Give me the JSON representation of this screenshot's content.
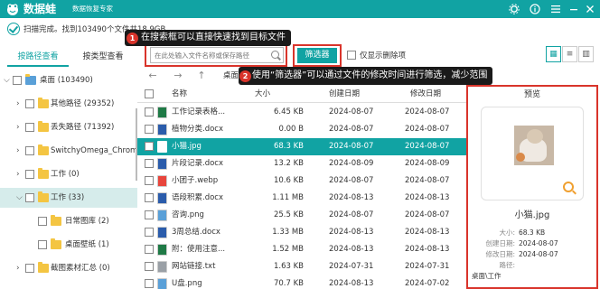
{
  "app": {
    "name": "数据蛙",
    "subtitle": "数据恢复专家"
  },
  "titlebar": {
    "buttons": [
      "gear-icon",
      "info-icon",
      "menu-icon",
      "minimize-icon",
      "close-icon"
    ]
  },
  "scan": {
    "status": "扫描完成。找到103490个文件共18.9GB"
  },
  "tooltip1": {
    "number": "1",
    "text": "在搜索框可以直接快速找到目标文件"
  },
  "tooltip2": {
    "number": "2",
    "text": "使用“筛选器”可以通过文件的修改时间进行筛选，减少范围"
  },
  "sidebar": {
    "tabs": [
      {
        "label": "按路径查看",
        "active": true
      },
      {
        "label": "按类型查看",
        "active": false
      }
    ],
    "tree": [
      {
        "label": "桌面 (103490)",
        "expanded": true,
        "level": 0
      },
      {
        "label": "其他路径 (29352)",
        "expanded": false,
        "level": 1
      },
      {
        "label": "丢失路径 (71392)",
        "expanded": false,
        "level": 1
      },
      {
        "label": "SwitchyOmega_Chromium",
        "expanded": false,
        "level": 1
      },
      {
        "label": "工作 (0)",
        "expanded": false,
        "level": 1
      },
      {
        "label": "工作 (33)",
        "expanded": true,
        "level": 1,
        "selected": true
      },
      {
        "label": "日常图库 (2)",
        "level": 2
      },
      {
        "label": "桌面壁纸 (1)",
        "level": 2
      },
      {
        "label": "截图素材汇总 (0)",
        "expanded": false,
        "level": 1
      }
    ]
  },
  "toolbar": {
    "search_placeholder": "在此处输入文件名称或保存路径",
    "filter_label": "筛选器",
    "show_deleted_label": "仅显示删除项",
    "view_modes": [
      "grid-view-icon",
      "list-view-icon",
      "detail-view-icon"
    ]
  },
  "nav": {
    "path": "桌面"
  },
  "table": {
    "headers": {
      "name": "名称",
      "size": "大小",
      "created": "创建日期",
      "modified": "修改日期"
    },
    "rows": [
      {
        "name": "工作记录表格...",
        "size": "6.45 KB",
        "created": "2024-08-07",
        "modified": "2024-08-07",
        "icon": "excel",
        "color": "#1f7a46"
      },
      {
        "name": "植物分类.docx",
        "size": "0.00 B",
        "created": "2024-08-07",
        "modified": "2024-08-07",
        "icon": "word",
        "color": "#2b5cab"
      },
      {
        "name": "小猫.jpg",
        "size": "68.3 KB",
        "created": "2024-08-07",
        "modified": "2024-08-07",
        "icon": "image",
        "color": "#ffffff",
        "selected": true
      },
      {
        "name": "片段记录.docx",
        "size": "13.2 KB",
        "created": "2024-08-09",
        "modified": "2024-08-09",
        "icon": "word",
        "color": "#2b5cab"
      },
      {
        "name": "小团子.webp",
        "size": "10.6 KB",
        "created": "2024-08-07",
        "modified": "2024-08-07",
        "icon": "chrome",
        "color": "#e8453c"
      },
      {
        "name": "语段积累.docx",
        "size": "1.11 MB",
        "created": "2024-08-13",
        "modified": "2024-08-13",
        "icon": "word",
        "color": "#2b5cab"
      },
      {
        "name": "咨询.png",
        "size": "25.5 KB",
        "created": "2024-08-07",
        "modified": "2024-08-07",
        "icon": "image",
        "color": "#5aa0d8"
      },
      {
        "name": "3周总结.docx",
        "size": "1.33 MB",
        "created": "2024-08-13",
        "modified": "2024-08-13",
        "icon": "word",
        "color": "#2b5cab"
      },
      {
        "name": "附：使用注意...",
        "size": "1.52 MB",
        "created": "2024-08-13",
        "modified": "2024-08-13",
        "icon": "excel",
        "color": "#1f7a46"
      },
      {
        "name": "网站链接.txt",
        "size": "1.63 KB",
        "created": "2024-07-31",
        "modified": "2024-07-31",
        "icon": "text",
        "color": "#9aa0a6"
      },
      {
        "name": "U盘.png",
        "size": "70.7 KB",
        "created": "2024-08-13",
        "modified": "2024-07-02",
        "icon": "image",
        "color": "#5aa0d8"
      }
    ]
  },
  "preview": {
    "title": "预览",
    "filename": "小猫.jpg",
    "details": [
      {
        "label": "大小:",
        "value": "68.3 KB"
      },
      {
        "label": "创建日期:",
        "value": "2024-08-07"
      },
      {
        "label": "修改日期:",
        "value": "2024-08-07"
      },
      {
        "label": "路径:",
        "value": ""
      },
      {
        "label": "",
        "value": "桌面\\工作"
      }
    ]
  },
  "colors": {
    "accent": "#11a3a3",
    "highlight": "#d9342b",
    "tooltip_bg": "#1a1a1a"
  }
}
